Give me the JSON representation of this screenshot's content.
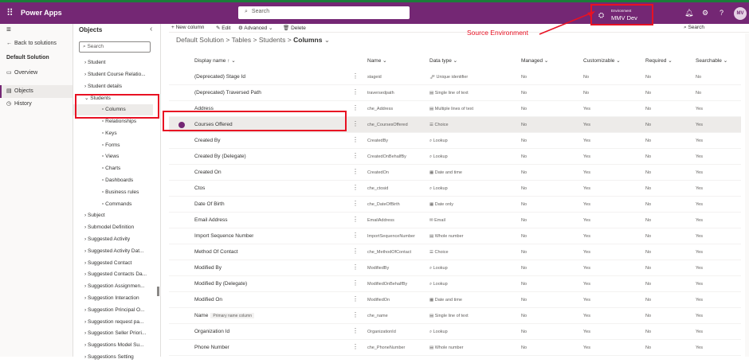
{
  "app": {
    "name": "Power Apps",
    "search_placeholder": "Search"
  },
  "environment": {
    "label": "Environment",
    "name": "MMV Dev",
    "annotation": "Source Environment"
  },
  "user": {
    "initials": "MV"
  },
  "leftnav": {
    "back": "Back to solutions",
    "solution": "Default Solution",
    "items": [
      {
        "label": "Overview"
      },
      {
        "label": "Objects"
      },
      {
        "label": "History"
      }
    ]
  },
  "objects": {
    "title": "Objects",
    "search_placeholder": "Search",
    "tree": [
      {
        "label": "Student",
        "level": 0
      },
      {
        "label": "Student Course Relatio...",
        "level": 0
      },
      {
        "label": "Student details",
        "level": 0
      },
      {
        "label": "Students",
        "level": 0,
        "expanded": true
      },
      {
        "label": "Columns",
        "level": 1,
        "selected": true
      },
      {
        "label": "Relationships",
        "level": 1
      },
      {
        "label": "Keys",
        "level": 1
      },
      {
        "label": "Forms",
        "level": 1
      },
      {
        "label": "Views",
        "level": 1
      },
      {
        "label": "Charts",
        "level": 1
      },
      {
        "label": "Dashboards",
        "level": 1
      },
      {
        "label": "Business rules",
        "level": 1
      },
      {
        "label": "Commands",
        "level": 1
      },
      {
        "label": "Subject",
        "level": 0
      },
      {
        "label": "Submodel Definition",
        "level": 0
      },
      {
        "label": "Suggested Activity",
        "level": 0
      },
      {
        "label": "Suggested Activity Dat...",
        "level": 0
      },
      {
        "label": "Suggested Contact",
        "level": 0
      },
      {
        "label": "Suggested Contacts Da...",
        "level": 0
      },
      {
        "label": "Suggestion Assignmen...",
        "level": 0
      },
      {
        "label": "Suggestion Interaction",
        "level": 0
      },
      {
        "label": "Suggestion Principal O...",
        "level": 0
      },
      {
        "label": "Suggestion request pa...",
        "level": 0
      },
      {
        "label": "Suggestion Seller Priori...",
        "level": 0
      },
      {
        "label": "Suggestions Model Su...",
        "level": 0
      },
      {
        "label": "Suggestions Setting",
        "level": 0
      }
    ]
  },
  "commands": {
    "new_column": "New column",
    "edit": "Edit",
    "advanced": "Advanced",
    "delete": "Delete",
    "search": "Search"
  },
  "breadcrumb": {
    "a": "Default Solution",
    "b": "Tables",
    "c": "Students",
    "d": "Columns"
  },
  "columns": {
    "display_name": "Display name",
    "name": "Name",
    "data_type": "Data type",
    "managed": "Managed",
    "customizable": "Customizable",
    "required": "Required",
    "searchable": "Searchable"
  },
  "rows": [
    {
      "display": "(Deprecated) Stage Id",
      "name": "stageid",
      "type": "Unique identifier",
      "type_icon": "🗝",
      "managed": "No",
      "customizable": "No",
      "required": "No",
      "searchable": "No"
    },
    {
      "display": "(Deprecated) Traversed Path",
      "name": "traversedpath",
      "type": "Single line of text",
      "type_icon": "▤",
      "managed": "No",
      "customizable": "No",
      "required": "No",
      "searchable": "No"
    },
    {
      "display": "Address",
      "name": "che_Address",
      "type": "Multiple lines of text",
      "type_icon": "▤",
      "managed": "No",
      "customizable": "Yes",
      "required": "No",
      "searchable": "Yes"
    },
    {
      "display": "Courses Offered",
      "name": "che_CoursesOffered",
      "type": "Choice",
      "type_icon": "☰",
      "managed": "No",
      "customizable": "Yes",
      "required": "No",
      "searchable": "Yes",
      "selected": true
    },
    {
      "display": "Created By",
      "name": "CreatedBy",
      "type": "Lookup",
      "type_icon": "⌕",
      "managed": "No",
      "customizable": "Yes",
      "required": "No",
      "searchable": "Yes"
    },
    {
      "display": "Created By (Delegate)",
      "name": "CreatedOnBehalfBy",
      "type": "Lookup",
      "type_icon": "⌕",
      "managed": "No",
      "customizable": "Yes",
      "required": "No",
      "searchable": "Yes"
    },
    {
      "display": "Created On",
      "name": "CreatedOn",
      "type": "Date and time",
      "type_icon": "▦",
      "managed": "No",
      "customizable": "Yes",
      "required": "No",
      "searchable": "Yes"
    },
    {
      "display": "Ctos",
      "name": "che_ctosid",
      "type": "Lookup",
      "type_icon": "⌕",
      "managed": "No",
      "customizable": "Yes",
      "required": "No",
      "searchable": "Yes"
    },
    {
      "display": "Date Of Birth",
      "name": "che_DateOfBirth",
      "type": "Date only",
      "type_icon": "▦",
      "managed": "No",
      "customizable": "Yes",
      "required": "No",
      "searchable": "Yes"
    },
    {
      "display": "Email Address",
      "name": "EmailAddress",
      "type": "Email",
      "type_icon": "✉",
      "managed": "No",
      "customizable": "Yes",
      "required": "No",
      "searchable": "Yes"
    },
    {
      "display": "Import Sequence Number",
      "name": "ImportSequenceNumber",
      "type": "Whole number",
      "type_icon": "▤",
      "managed": "No",
      "customizable": "Yes",
      "required": "No",
      "searchable": "Yes"
    },
    {
      "display": "Method Of Contact",
      "name": "che_MethodOfContact",
      "type": "Choice",
      "type_icon": "☰",
      "managed": "No",
      "customizable": "Yes",
      "required": "No",
      "searchable": "Yes"
    },
    {
      "display": "Modified By",
      "name": "ModifiedBy",
      "type": "Lookup",
      "type_icon": "⌕",
      "managed": "No",
      "customizable": "Yes",
      "required": "No",
      "searchable": "Yes"
    },
    {
      "display": "Modified By (Delegate)",
      "name": "ModifiedOnBehalfBy",
      "type": "Lookup",
      "type_icon": "⌕",
      "managed": "No",
      "customizable": "Yes",
      "required": "No",
      "searchable": "Yes"
    },
    {
      "display": "Modified On",
      "name": "ModifiedOn",
      "type": "Date and time",
      "type_icon": "▦",
      "managed": "No",
      "customizable": "Yes",
      "required": "No",
      "searchable": "Yes"
    },
    {
      "display": "Name",
      "name": "che_name",
      "type": "Single line of text",
      "type_icon": "▤",
      "managed": "No",
      "customizable": "Yes",
      "required": "No",
      "searchable": "Yes",
      "badge": "Primary name column"
    },
    {
      "display": "Organization Id",
      "name": "OrganizationId",
      "type": "Lookup",
      "type_icon": "⌕",
      "managed": "No",
      "customizable": "Yes",
      "required": "No",
      "searchable": "Yes"
    },
    {
      "display": "Phone Number",
      "name": "che_PhoneNumber",
      "type": "Whole number",
      "type_icon": "▤",
      "managed": "No",
      "customizable": "Yes",
      "required": "No",
      "searchable": "Yes"
    }
  ],
  "colors": {
    "brand": "#742774",
    "accent_green": "#1b7c3a",
    "highlight": "#e81123"
  }
}
